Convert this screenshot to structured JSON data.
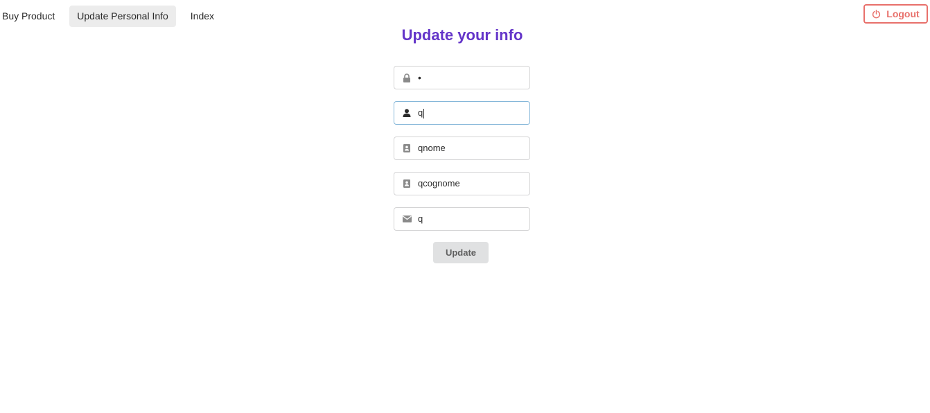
{
  "nav": {
    "items": [
      {
        "label": "Buy Product",
        "active": false
      },
      {
        "label": "Update Personal Info",
        "active": true
      },
      {
        "label": "Index",
        "active": false
      }
    ],
    "logout_label": "Logout"
  },
  "page": {
    "title": "Update your info"
  },
  "form": {
    "fields": [
      {
        "icon": "lock-icon",
        "value": "•",
        "focused": false
      },
      {
        "icon": "user-icon",
        "value": "q",
        "focused": true
      },
      {
        "icon": "address-card-icon",
        "value": "qnome",
        "focused": false
      },
      {
        "icon": "address-card-icon",
        "value": "qcognome",
        "focused": false
      },
      {
        "icon": "envelope-icon",
        "value": "q",
        "focused": false
      }
    ],
    "submit_label": "Update"
  },
  "colors": {
    "title": "#6435c9",
    "logout": "#e8706b",
    "focus_border": "#85b7d9",
    "button_bg": "#e0e1e2"
  }
}
